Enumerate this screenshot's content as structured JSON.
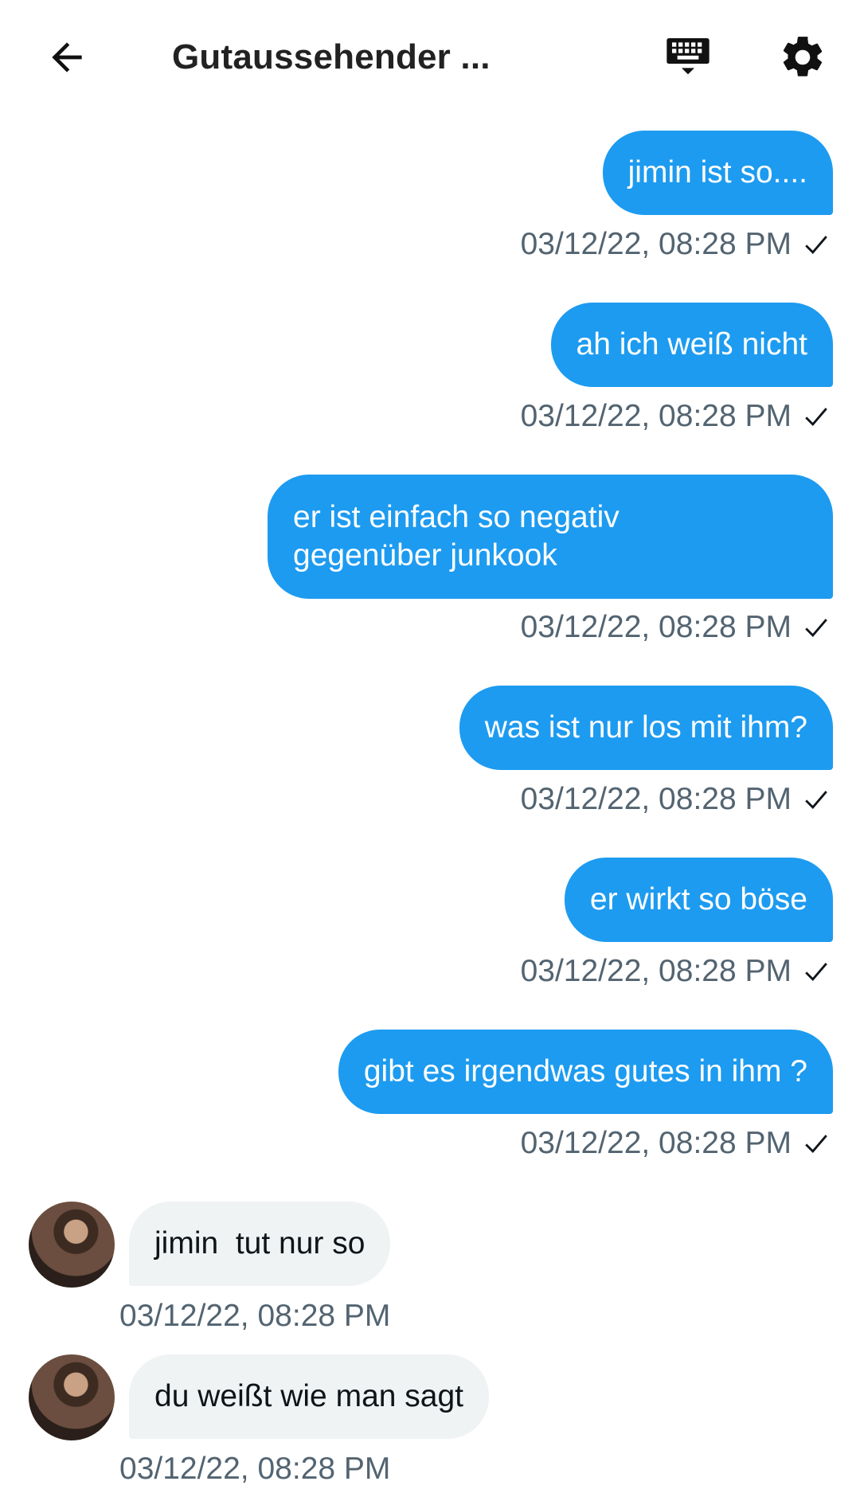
{
  "header": {
    "title": "Gutaussehender ...",
    "back_icon": "arrow-left-icon",
    "keyboard_icon": "keyboard-icon",
    "settings_icon": "gear-icon"
  },
  "colors": {
    "outgoing_bubble": "#1d9bf0",
    "incoming_bubble": "#eff3f4",
    "timestamp": "#536471"
  },
  "messages": [
    {
      "direction": "outgoing",
      "text": "jimin ist so....",
      "time": "03/12/22, 08:28 PM",
      "read": true
    },
    {
      "direction": "outgoing",
      "text": "ah ich weiß nicht",
      "time": "03/12/22, 08:28 PM",
      "read": true
    },
    {
      "direction": "outgoing",
      "text": "er ist einfach so negativ\ngegenüber junkook",
      "time": "03/12/22, 08:28 PM",
      "read": true
    },
    {
      "direction": "outgoing",
      "text": "was ist nur los mit ihm?",
      "time": "03/12/22, 08:28 PM",
      "read": true
    },
    {
      "direction": "outgoing",
      "text": "er wirkt so böse",
      "time": "03/12/22, 08:28 PM",
      "read": true
    },
    {
      "direction": "outgoing",
      "text": "gibt es irgendwas gutes in ihm ?",
      "time": "03/12/22, 08:28 PM",
      "read": true
    },
    {
      "direction": "incoming",
      "text": "jimin  tut nur so",
      "time": "03/12/22, 08:28 PM"
    },
    {
      "direction": "incoming",
      "text": "du weißt wie man sagt",
      "time": "03/12/22, 08:28 PM"
    }
  ]
}
